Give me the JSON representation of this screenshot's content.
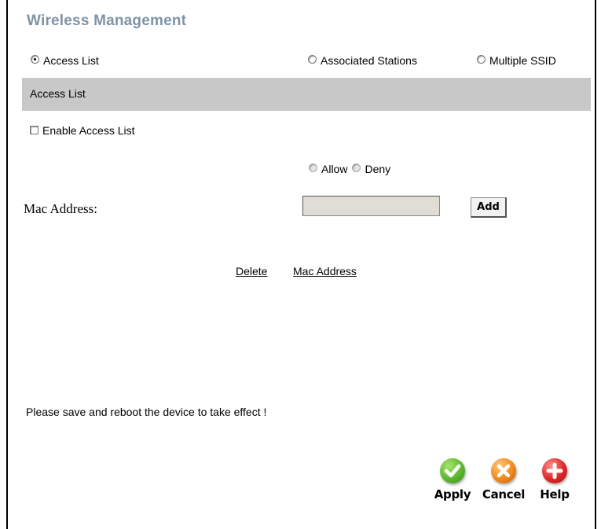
{
  "title": "Wireless Management",
  "tabs": [
    {
      "label": "Access List",
      "selected": true
    },
    {
      "label": "Associated Stations",
      "selected": false
    },
    {
      "label": "Multiple SSID",
      "selected": false
    }
  ],
  "section": {
    "title": "Access List"
  },
  "enable_access_list": {
    "label": "Enable Access List",
    "checked": false
  },
  "policy": {
    "allow_label": "Allow",
    "deny_label": "Deny",
    "selected": "none"
  },
  "mac": {
    "label": "Mac Address:",
    "value": "",
    "add_label": "Add"
  },
  "table": {
    "headers": [
      "Delete",
      "Mac Address"
    ],
    "rows": []
  },
  "notice": "Please save and reboot the device to take effect !",
  "actions": {
    "apply": {
      "label": "Apply",
      "icon": "check-icon",
      "color": "#5cb82f"
    },
    "cancel": {
      "label": "Cancel",
      "icon": "x-icon",
      "color": "#f08a1c"
    },
    "help": {
      "label": "Help",
      "icon": "plus-icon",
      "color": "#e0262a"
    }
  }
}
